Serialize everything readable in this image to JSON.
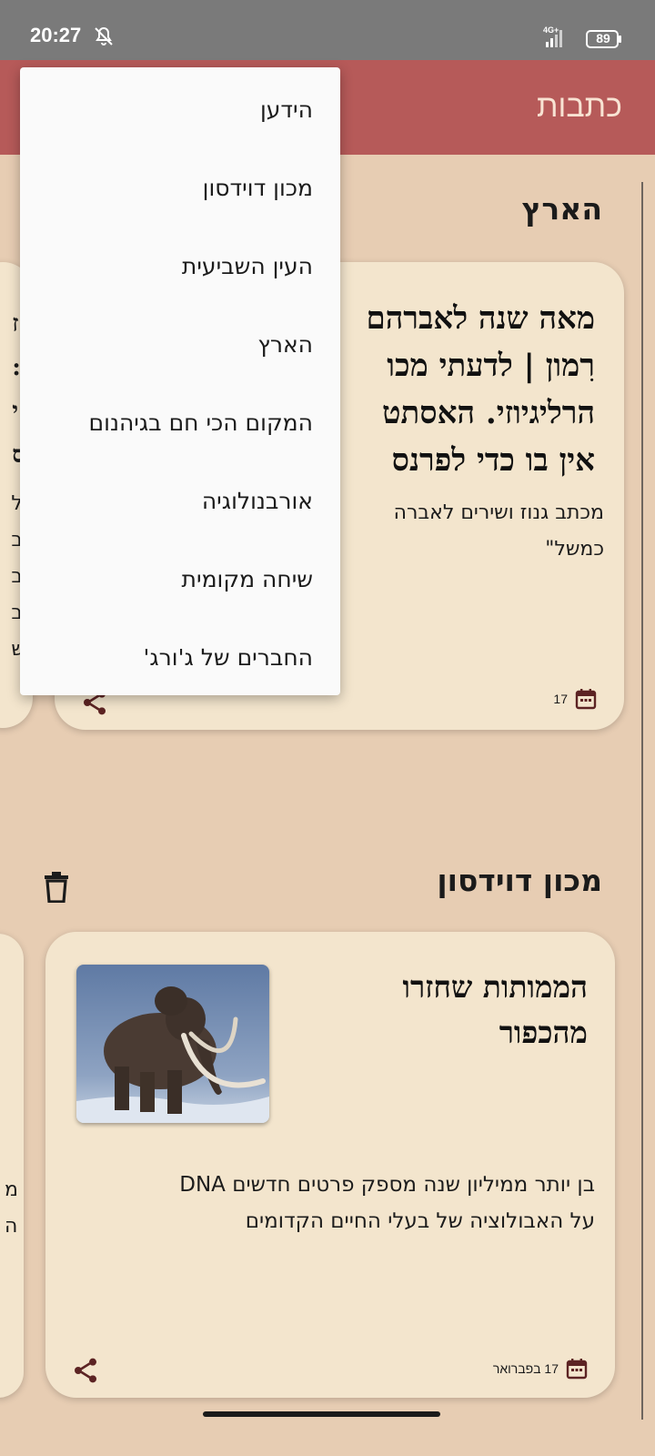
{
  "status": {
    "time": "20:27",
    "network": "4G+",
    "battery": "89"
  },
  "app": {
    "title": "כתבות"
  },
  "sections": [
    {
      "title": "הארץ",
      "card": {
        "headline_lines": [
          "מאה שנה לאברהם",
          "רִמון | לדעתי מכו",
          "הרליגיוזי. האסתט",
          "אין בו כדי לפרנס"
        ],
        "summary_lines": [
          "מכתב גנוז ושירים לאברה",
          "כמשל\""
        ],
        "date": "17"
      },
      "peek_left": [
        "ז",
        ":",
        "י",
        "ס",
        "ל",
        "ב",
        "ב",
        "ב",
        "ש"
      ]
    },
    {
      "title": "מכון דוידסון",
      "card": {
        "headline_lines": [
          "הממותות שחזרו",
          "מהכפור"
        ],
        "summary_lines": [
          "בן יותר ממיליון שנה מספק פרטים חדשים DNA",
          "על האבולוציה של בעלי החיים הקדומים"
        ],
        "date": "17 בפברואר",
        "image_alt": "mammoth"
      },
      "peek_left": [
        "מ",
        "ה"
      ]
    }
  ],
  "menu": {
    "items": [
      "הידען",
      "מכון דוידסון",
      "העין השביעית",
      "הארץ",
      "המקום הכי חם בגיהנום",
      "אורבנולוגיה",
      "שיחה מקומית",
      "החברים של ג'ורג'"
    ]
  },
  "colors": {
    "appbar": "#b65a59",
    "background": "#e7cdb3",
    "card": "#f3e5cd",
    "accent_icon": "#5c2323"
  }
}
